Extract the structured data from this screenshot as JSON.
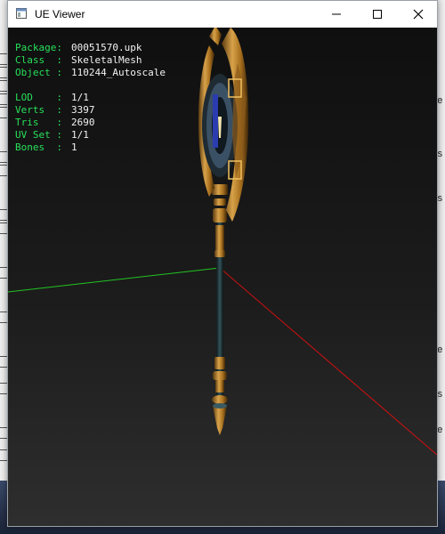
{
  "window": {
    "title": "UE Viewer"
  },
  "controls": {
    "minimize": "minimize",
    "maximize": "maximize",
    "close": "close"
  },
  "info": {
    "package": {
      "key": "Package:",
      "value": "00051570.upk"
    },
    "class": {
      "key": "Class  :",
      "value": "SkeletalMesh"
    },
    "object": {
      "key": "Object :",
      "value": "110244_Autoscale"
    },
    "lod": {
      "key": "LOD    :",
      "value": "1/1"
    },
    "verts": {
      "key": "Verts  :",
      "value": "3397"
    },
    "tris": {
      "key": "Tris   :",
      "value": "2690"
    },
    "uvset": {
      "key": "UV Set :",
      "value": "1/1"
    },
    "bones": {
      "key": "Bones  :",
      "value": "1"
    }
  },
  "colors": {
    "label": "#27e05a",
    "value": "#f2f2f2",
    "axis_x": "#d01010",
    "axis_y": "#22c422"
  },
  "background_right": [
    "e",
    "s",
    "s",
    "e",
    "s",
    "e"
  ]
}
